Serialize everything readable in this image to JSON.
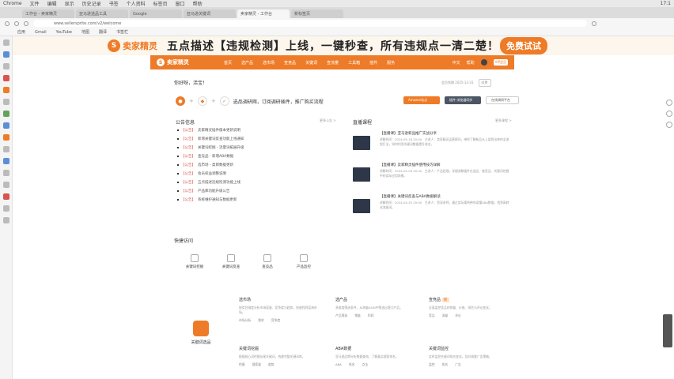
{
  "mac": {
    "app": "Chrome",
    "menus": [
      "文件",
      "编辑",
      "显示",
      "历史记录",
      "书签",
      "个人资料",
      "标签页",
      "窗口",
      "帮助"
    ],
    "time": "17:1"
  },
  "tabs": [
    "工作台 - 卖家精灵",
    "亚马逊选品工具",
    "Google",
    "亚马逊关键词",
    "卖家精灵 - 工作台",
    "新标签页"
  ],
  "addr": "www.sellersprite.com/v2/welcome",
  "bookmarks": [
    "应用",
    "Gmail",
    "YouTube",
    "地图",
    "翻译",
    "书签栏"
  ],
  "ad": {
    "brand": "卖家精灵",
    "text": "五点描述【违规检测】上线，一键秒查，所有违规点一清二楚！",
    "btn": "免费试试"
  },
  "nav": {
    "brand": "卖家精灵",
    "items": [
      "首页",
      "选产品",
      "选市场",
      "查竞品",
      "关键词",
      "查流量",
      "工具箱",
      "插件",
      "服务"
    ],
    "right": [
      "中文",
      "帮助"
    ],
    "vip": "VIP会员"
  },
  "welcome": {
    "greet": "你好呀，活宝！",
    "right1": "会员到期 2025-12-31",
    "right2": "续费"
  },
  "steps": {
    "text": "选品调研网，订阅调研插件，推广购买流程"
  },
  "actions": [
    "Amazon站点",
    "插件-浏览器同步",
    "在线调研平台"
  ],
  "notices": {
    "title": "公告信息",
    "more": "更多公告 >",
    "items": [
      [
        "【公告】",
        "卖家精灵插件版本更新说明"
      ],
      [
        "【公告】",
        "新增关键词反查功能上线通知"
      ],
      [
        "【公告】",
        "关键词挖掘 - 流量词拓展升级"
      ],
      [
        "【公告】",
        "查竞品 - 新增ABA数据"
      ],
      [
        "【公告】",
        "选市场 - 类目数据更新"
      ],
      [
        "【公告】",
        "会员权益调整说明"
      ],
      [
        "【公告】",
        "五点描述违规检测功能上线"
      ],
      [
        "【公告】",
        "产品库功能升级公告"
      ],
      [
        "【公告】",
        "系统维护通知与数据更新"
      ]
    ]
  },
  "courses": {
    "title": "直播课程",
    "more": "更多课程 >",
    "items": [
      {
        "t": "【直播课】亚马逊新品推广实战分享",
        "d": "讲解时间：2024-05-16 20:00　主讲人：卖家精灵运营顾问，带你了解新品从上架到出单的全流程打法，如何利用关键词数据提升排名。"
      },
      {
        "t": "【直播课】卖家精灵插件使用技巧详解",
        "d": "讲解时间：2024-05-09 20:00　主讲人：产品经理，详细讲解插件在选品、查竞品、关键词挖掘中的实际应用场景。"
      },
      {
        "t": "【直播课】关键词反查与ABA数据解读",
        "d": "讲解时间：2024-04-25 20:00　主讲人：资深讲师，通过实际案例带你读懂ABA数据，找到高转化流量词。"
      }
    ]
  },
  "quick": {
    "title": "快捷访问",
    "items": [
      "关键词挖掘",
      "关键词反查",
      "查竞品",
      "产品监控"
    ]
  },
  "tools": {
    "brand": "关键词选品",
    "items": [
      {
        "n": "选市场",
        "d": "按类目维度分析市场容量、竞争度与趋势，快速找到蓝海市场。",
        "r": [
          "市场分析",
          "需求",
          "竞争度"
        ]
      },
      {
        "n": "选产品",
        "d": "多维度筛选条件，从海量ASIN中筛选出潜力产品。",
        "r": [
          "产品筛选",
          "销量",
          "利润"
        ]
      },
      {
        "n": "查竞品",
        "d": "全面监控竞品的销量、价格、排名与评论变化。",
        "r": [
          "竞品",
          "流量",
          "评论"
        ],
        "tag": "新"
      },
      {
        "n": "关键词挖掘",
        "d": "根据核心词挖掘长尾关键词，构建完整关键词库。",
        "r": [
          "挖掘",
          "搜索量",
          "趋势"
        ]
      },
      {
        "n": "ABA数据",
        "d": "亚马逊品牌分析数据查询，了解真实搜索排名。",
        "r": [
          "ABA",
          "排名",
          "点击"
        ]
      },
      {
        "n": "关键词监控",
        "d": "实时监控关键词排名变化，及时调整广告策略。",
        "r": [
          "监控",
          "排名",
          "广告"
        ]
      }
    ]
  }
}
